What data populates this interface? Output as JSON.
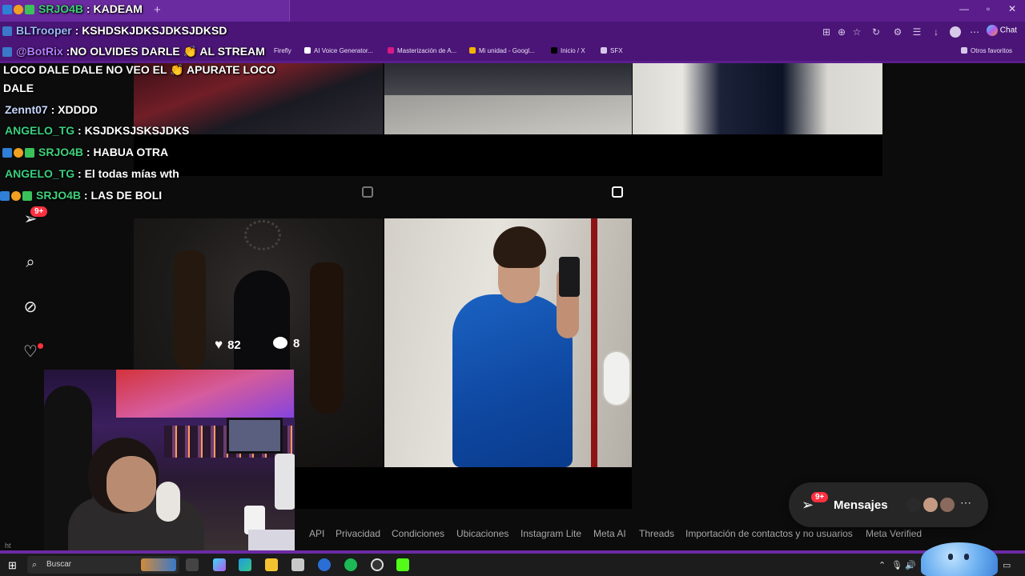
{
  "browser": {
    "bookmarks": [
      {
        "label": "Firefly",
        "color": "#e04a3a"
      },
      {
        "label": "AI Voice Generator...",
        "color": "#ffffff"
      },
      {
        "label": "Masterización de A...",
        "color": "#d61b83"
      },
      {
        "label": "Mi unidad - Googl...",
        "color": "#f4b400"
      },
      {
        "label": "Inicio / X",
        "color": "#000000"
      },
      {
        "label": "SFX",
        "color": "#d8c6ea"
      }
    ],
    "other_favorites": "Otros favoritos",
    "chat_label": "Chat"
  },
  "instagram": {
    "post_likes": "82",
    "post_comments": "8",
    "notifications_badge": "9+",
    "messages_badge": "9+",
    "messages_label": "Mensajes",
    "footer_links": [
      "API",
      "Privacidad",
      "Condiciones",
      "Ubicaciones",
      "Instagram Lite",
      "Meta AI",
      "Threads",
      "Importación de contactos y no usuarios",
      "Meta Verified"
    ],
    "url_fragment": "ht"
  },
  "chat": [
    {
      "user": "SRJO4B",
      "color": "#3fd07a",
      "message": " : KADEAM",
      "badges": true
    },
    {
      "user": "BLTrooper",
      "color": "#9bb8ff",
      "message": " : KSHDSKJDKSJDKSJDKSD",
      "badges": false
    },
    {
      "user": "@BotRix",
      "color": "#b37cff",
      "message": " :NO OLVIDES DARLE 👏 AL STREAM",
      "badges": false
    },
    {
      "user": "",
      "color": "#ffffff",
      "message": "LOCO DALE DALE NO VEO EL 👏 APURATE LOCO",
      "badges": false
    },
    {
      "user": "",
      "color": "#ffffff",
      "message": "DALE",
      "badges": false
    },
    {
      "user": "Zennt07",
      "color": "#c9d7ff",
      "message": " : XDDDD",
      "badges": false
    },
    {
      "user": "ANGELO_TG",
      "color": "#3ad07f",
      "message": " : KSJDKSJSKSJDKS",
      "badges": false
    },
    {
      "user": "SRJO4B",
      "color": "#3fd07a",
      "message": " : HABUA OTRA",
      "badges": true
    },
    {
      "user": "ANGELO_TG",
      "color": "#3ad07f",
      "message": " : El todas mías wth",
      "badges": false
    },
    {
      "user": "SRJO4B",
      "color": "#3fd07a",
      "message": " : LAS DE BOLI",
      "badges": true
    }
  ],
  "taskbar": {
    "search_placeholder": "Buscar"
  },
  "colors": {
    "browser_purple": "#5b1d8c",
    "ig_background": "#0c0c0c",
    "badge_red": "#ff3040"
  }
}
